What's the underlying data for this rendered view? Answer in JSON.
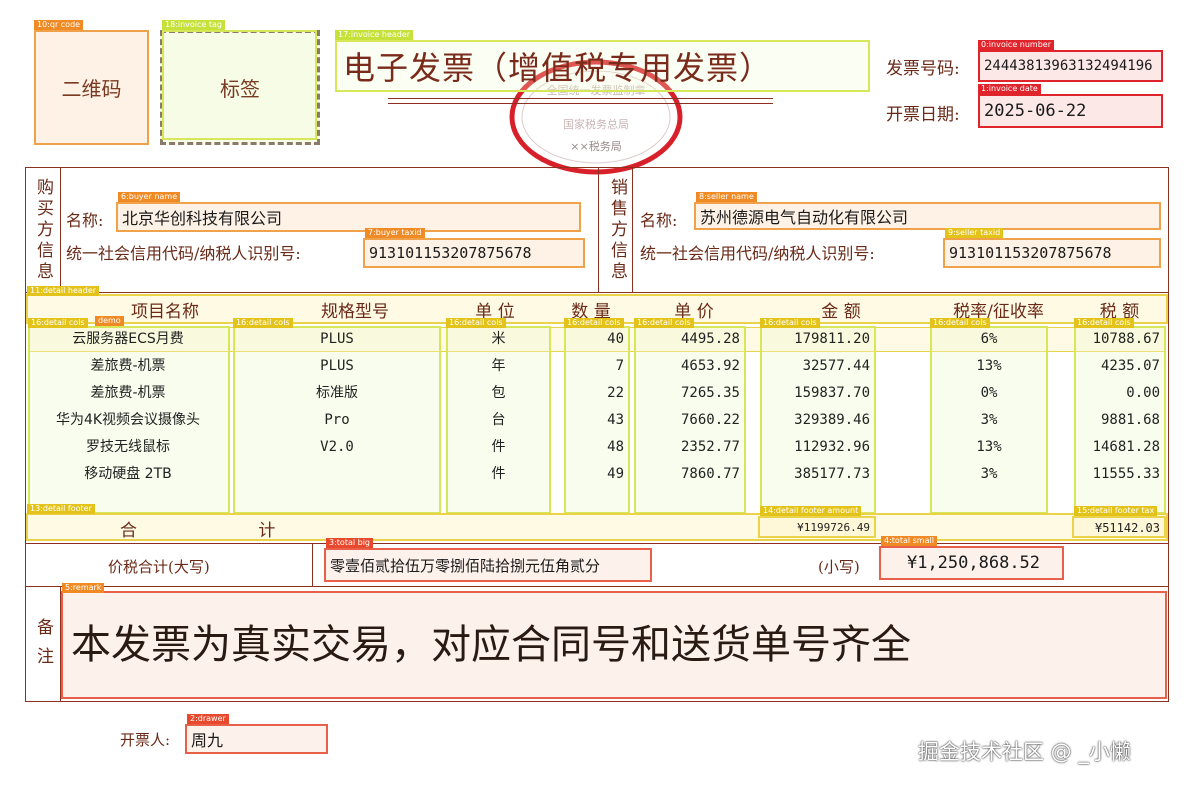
{
  "tags": {
    "qr": "10:qr code",
    "invoice_tag": "18:invoice tag",
    "header": "17:invoice header",
    "number": "0:invoice number",
    "date": "1:invoice date",
    "buyer_name": "6:buyer name",
    "buyer_taxid": "7:buyer taxid",
    "seller_name": "8:seller name",
    "seller_taxid": "9:seller taxid",
    "detail_header": "11:detail header",
    "detail_cols": "16:detail cols",
    "demo": "demo",
    "detail_footer": "13:detail footer",
    "detail_footer_amount": "14:detail footer amount",
    "detail_footer_tax": "15:detail footer tax",
    "total_big": "3:total big",
    "total_small": "4:total small",
    "remark": "5:remark",
    "drawer": "2:drawer"
  },
  "invoice": {
    "qr_text": "二维码",
    "tag_text": "标签",
    "title": "电子发票（增值税专用发票）",
    "seal_top": "全国统一发票监制章",
    "seal_mid": "国家税务总局",
    "seal_bottom": "××税务局",
    "number_label": "发票号码:",
    "number": "24443813963132494196",
    "date_label": "开票日期:",
    "date": "2025-06-22"
  },
  "buyer": {
    "side_label": "购买方信息",
    "name_label": "名称:",
    "name": "北京华创科技有限公司",
    "taxid_label": "统一社会信用代码/纳税人识别号:",
    "taxid": "913101153207875678"
  },
  "seller": {
    "side_label": "销售方信息",
    "name_label": "名称:",
    "name": "苏州德源电气自动化有限公司",
    "taxid_label": "统一社会信用代码/纳税人识别号:",
    "taxid": "913101153207875678"
  },
  "detail": {
    "headers": [
      "项目名称",
      "规格型号",
      "单 位",
      "数 量",
      "单 价",
      "金 额",
      "税率/征收率",
      "税 额"
    ],
    "rows": [
      [
        "云服务器ECS月费",
        "PLUS",
        "米",
        "40",
        "4495.28",
        "179811.20",
        "6%",
        "10788.67"
      ],
      [
        "差旅费-机票",
        "PLUS",
        "年",
        "7",
        "4653.92",
        "32577.44",
        "13%",
        "4235.07"
      ],
      [
        "差旅费-机票",
        "标准版",
        "包",
        "22",
        "7265.35",
        "159837.70",
        "0%",
        "0.00"
      ],
      [
        "华为4K视频会议摄像头",
        "Pro",
        "台",
        "43",
        "7660.22",
        "329389.46",
        "3%",
        "9881.68"
      ],
      [
        "罗技无线鼠标",
        "V2.0",
        "件",
        "48",
        "2352.77",
        "112932.96",
        "13%",
        "14681.28"
      ],
      [
        "移动硬盘 2TB",
        "",
        "件",
        "49",
        "7860.77",
        "385177.73",
        "3%",
        "11555.33"
      ]
    ],
    "footer_label": "合 计",
    "footer_amount": "¥1199726.49",
    "footer_tax": "¥51142.03"
  },
  "totals": {
    "big_label": "价税合计(大写)",
    "big": "零壹佰贰拾伍万零捌佰陆拾捌元伍角贰分",
    "small_label": "(小写)",
    "small": "¥1,250,868.52"
  },
  "remark": {
    "label": "备注",
    "text": "本发票为真实交易，对应合同号和送货单号齐全"
  },
  "drawer": {
    "label": "开票人:",
    "name": "周九"
  },
  "watermark": "掘金技术社区 @ _小懒",
  "colors": {
    "frame": "#8c3020",
    "orange": "#f08a24",
    "yellow": "#e3c21a",
    "lime": "#c6e13a",
    "red": "#e0242c",
    "seal": "#d8202a"
  }
}
